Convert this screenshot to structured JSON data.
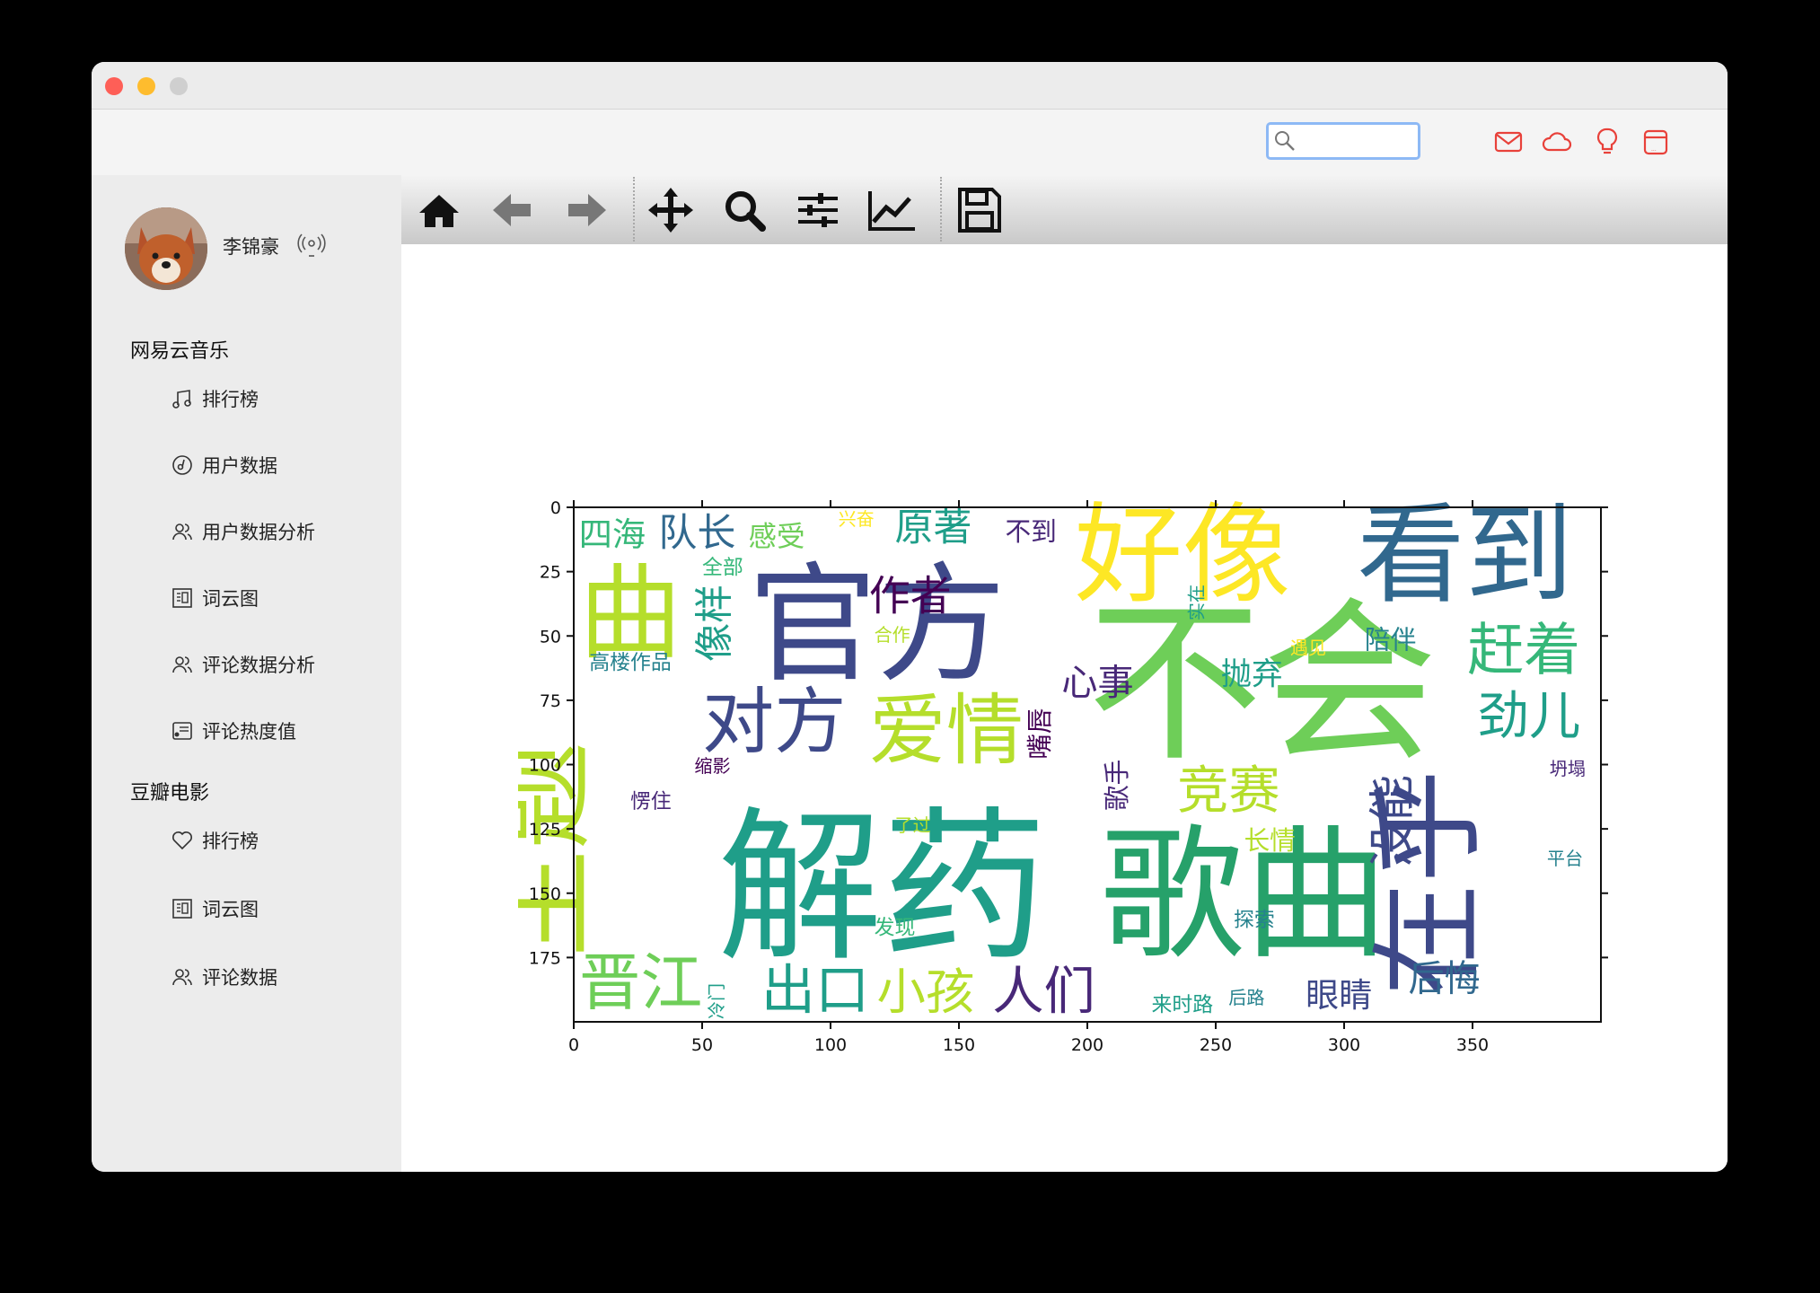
{
  "user": {
    "name": "李锦豪"
  },
  "search": {
    "value": "",
    "placeholder": ""
  },
  "sections": [
    {
      "title": "网易云音乐",
      "items": [
        {
          "label": "排行榜",
          "icon": "music-note-icon"
        },
        {
          "label": "用户数据",
          "icon": "clock-disc-icon"
        },
        {
          "label": "用户数据分析",
          "icon": "users-icon"
        },
        {
          "label": "词云图",
          "icon": "word-cloud-icon"
        },
        {
          "label": "评论数据分析",
          "icon": "users-icon"
        },
        {
          "label": "评论热度值",
          "icon": "heat-card-icon"
        }
      ]
    },
    {
      "title": "豆瓣电影",
      "items": [
        {
          "label": "排行榜",
          "icon": "heart-icon"
        },
        {
          "label": "词云图",
          "icon": "word-cloud-icon"
        },
        {
          "label": "评论数据",
          "icon": "users-icon"
        }
      ]
    }
  ],
  "top_icons": [
    "mail-icon",
    "cloud-icon",
    "lightbulb-icon",
    "card-icon"
  ],
  "toolbar": [
    "home-icon",
    "back-arrow-icon",
    "forward-arrow-icon",
    "pan-icon",
    "zoom-icon",
    "configure-subplots-icon",
    "edit-axis-icon",
    "save-icon"
  ],
  "colors": {
    "accent_red": "#e8413a",
    "search_focus": "#8db9f5",
    "viridis": [
      "#440154",
      "#482878",
      "#3e4989",
      "#31688e",
      "#26828e",
      "#1f9e89",
      "#35b779",
      "#6ece58",
      "#b5de2b",
      "#fde725"
    ]
  },
  "chart_data": {
    "type": "wordcloud-image",
    "xlim": [
      0,
      400
    ],
    "ylim": [
      200,
      0
    ],
    "xticks": [
      0,
      50,
      100,
      150,
      200,
      250,
      300,
      350
    ],
    "yticks": [
      0,
      25,
      50,
      75,
      100,
      125,
      150,
      175
    ],
    "words": [
      {
        "text": "不会",
        "x": 200,
        "y": 92,
        "size": 68,
        "color": "#6ece58"
      },
      {
        "text": "解药",
        "x": 56,
        "y": 170,
        "size": 64,
        "color": "#1f9e89"
      },
      {
        "text": "歌曲",
        "x": 205,
        "y": 170,
        "size": 56,
        "color": "#26a16a"
      },
      {
        "text": "官方",
        "x": 68,
        "y": 63,
        "size": 50,
        "color": "#3e4989"
      },
      {
        "text": "好像",
        "x": 195,
        "y": 33,
        "size": 42,
        "color": "#fde725"
      },
      {
        "text": "看到",
        "x": 305,
        "y": 33,
        "size": 42,
        "color": "#31688e"
      },
      {
        "text": "曲",
        "x": 2,
        "y": 55,
        "size": 40,
        "color": "#b5de2b"
      },
      {
        "text": "主题",
        "x": 2,
        "y": 175,
        "size": 42,
        "color": "#b5de2b",
        "vertical": true
      },
      {
        "text": "在乎",
        "x": 348,
        "y": 190,
        "size": 44,
        "color": "#3e4989",
        "vertical": true
      },
      {
        "text": "爱情",
        "x": 115,
        "y": 97,
        "size": 30,
        "color": "#b5de2b"
      },
      {
        "text": "对方",
        "x": 50,
        "y": 93,
        "size": 28,
        "color": "#3e4989"
      },
      {
        "text": "赶着",
        "x": 348,
        "y": 63,
        "size": 22,
        "color": "#35b779"
      },
      {
        "text": "劲儿",
        "x": 352,
        "y": 88,
        "size": 20,
        "color": "#1f9e89"
      },
      {
        "text": "四海",
        "x": 2,
        "y": 15,
        "size": 13,
        "color": "#35b779"
      },
      {
        "text": "队长",
        "x": 33,
        "y": 15,
        "size": 15,
        "color": "#31688e"
      },
      {
        "text": "感受",
        "x": 68,
        "y": 15,
        "size": 11,
        "color": "#6ece58"
      },
      {
        "text": "原著",
        "x": 125,
        "y": 13,
        "size": 15,
        "color": "#1f9e89"
      },
      {
        "text": "不到",
        "x": 168,
        "y": 13,
        "size": 10,
        "color": "#482878"
      },
      {
        "text": "兴奋",
        "x": 103,
        "y": 7,
        "size": 7,
        "color": "#fde725"
      },
      {
        "text": "作者",
        "x": 115,
        "y": 40,
        "size": 16,
        "color": "#440154"
      },
      {
        "text": "像样",
        "x": 60,
        "y": 60,
        "size": 15,
        "color": "#1f9e89",
        "vertical": true
      },
      {
        "text": "全部",
        "x": 50,
        "y": 26,
        "size": 8,
        "color": "#35b779"
      },
      {
        "text": "合作",
        "x": 117,
        "y": 52,
        "size": 7,
        "color": "#b5de2b"
      },
      {
        "text": "高楼作品",
        "x": 6,
        "y": 63,
        "size": 8,
        "color": "#26828e"
      },
      {
        "text": "心事",
        "x": 190,
        "y": 73,
        "size": 14,
        "color": "#482878"
      },
      {
        "text": "抛弃",
        "x": 252,
        "y": 69,
        "size": 12,
        "color": "#1f9e89"
      },
      {
        "text": "陪伴",
        "x": 308,
        "y": 55,
        "size": 10,
        "color": "#26828e"
      },
      {
        "text": "遇见",
        "x": 279,
        "y": 57,
        "size": 7,
        "color": "#fde725"
      },
      {
        "text": "实在",
        "x": 245,
        "y": 44,
        "size": 7,
        "color": "#1f9e89",
        "vertical": true
      },
      {
        "text": "嘴唇",
        "x": 185,
        "y": 98,
        "size": 10,
        "color": "#440154",
        "vertical": true
      },
      {
        "text": "歌手",
        "x": 215,
        "y": 118,
        "size": 10,
        "color": "#482878",
        "vertical": true
      },
      {
        "text": "竞赛",
        "x": 235,
        "y": 117,
        "size": 20,
        "color": "#b5de2b"
      },
      {
        "text": "没能",
        "x": 325,
        "y": 140,
        "size": 18,
        "color": "#3e4989",
        "vertical": true
      },
      {
        "text": "缩影",
        "x": 47,
        "y": 103,
        "size": 7,
        "color": "#440154"
      },
      {
        "text": "愣住",
        "x": 22,
        "y": 117,
        "size": 8,
        "color": "#482878"
      },
      {
        "text": "了过",
        "x": 125,
        "y": 126,
        "size": 7,
        "color": "#b5de2b"
      },
      {
        "text": "长情",
        "x": 261,
        "y": 133,
        "size": 10,
        "color": "#b5de2b"
      },
      {
        "text": "坍塌",
        "x": 380,
        "y": 104,
        "size": 7,
        "color": "#482878"
      },
      {
        "text": "平台",
        "x": 379,
        "y": 139,
        "size": 7,
        "color": "#26828e"
      },
      {
        "text": "探索",
        "x": 257,
        "y": 163,
        "size": 8,
        "color": "#26828e"
      },
      {
        "text": "发现",
        "x": 117,
        "y": 166,
        "size": 8,
        "color": "#35b779"
      },
      {
        "text": "晋江",
        "x": 2,
        "y": 193,
        "size": 24,
        "color": "#6ece58"
      },
      {
        "text": "出口",
        "x": 73,
        "y": 195,
        "size": 21,
        "color": "#1f9e89"
      },
      {
        "text": "小孩",
        "x": 118,
        "y": 195,
        "size": 19,
        "color": "#b5de2b"
      },
      {
        "text": "人们",
        "x": 163,
        "y": 195,
        "size": 20,
        "color": "#482878"
      },
      {
        "text": "眼睛",
        "x": 285,
        "y": 194,
        "size": 13,
        "color": "#3e4989"
      },
      {
        "text": "后悔",
        "x": 325,
        "y": 188,
        "size": 14,
        "color": "#31688e"
      },
      {
        "text": "来时路",
        "x": 225,
        "y": 196,
        "size": 8,
        "color": "#1f9e89"
      },
      {
        "text": "后路",
        "x": 255,
        "y": 193,
        "size": 7,
        "color": "#26828e"
      },
      {
        "text": "冷门",
        "x": 58,
        "y": 199,
        "size": 7,
        "color": "#1f9e89",
        "vertical": true
      }
    ]
  }
}
